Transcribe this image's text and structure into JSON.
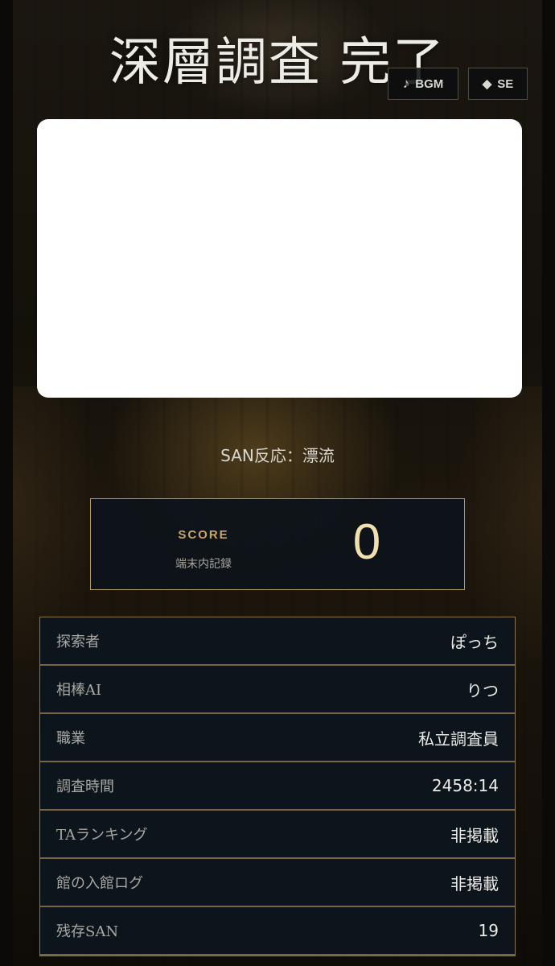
{
  "title": "深層調査 完了",
  "audio": {
    "bgm_label": "BGM",
    "bgm_icon": "music-note-icon",
    "se_label": "SE",
    "se_icon": "diamond-icon"
  },
  "san_reaction": "SAN反応：漂流",
  "score": {
    "label": "SCORE",
    "sub_label": "端末内記録",
    "value": "0"
  },
  "info_rows": [
    {
      "label": "探索者",
      "value": "ぽっち"
    },
    {
      "label": "相棒AI",
      "value": "りつ"
    },
    {
      "label": "職業",
      "value": "私立調査員"
    },
    {
      "label": "調査時間",
      "value": "2458:14"
    },
    {
      "label": "TAランキング",
      "value": "非掲載"
    },
    {
      "label": "館の入館ログ",
      "value": "非掲載"
    },
    {
      "label": "残存SAN",
      "value": "19"
    }
  ],
  "colors": {
    "accent_gold": "#c9a56a",
    "score_value": "#f1dfb0",
    "panel_bg": "#0c131a",
    "border_gold": "#b49a62"
  }
}
